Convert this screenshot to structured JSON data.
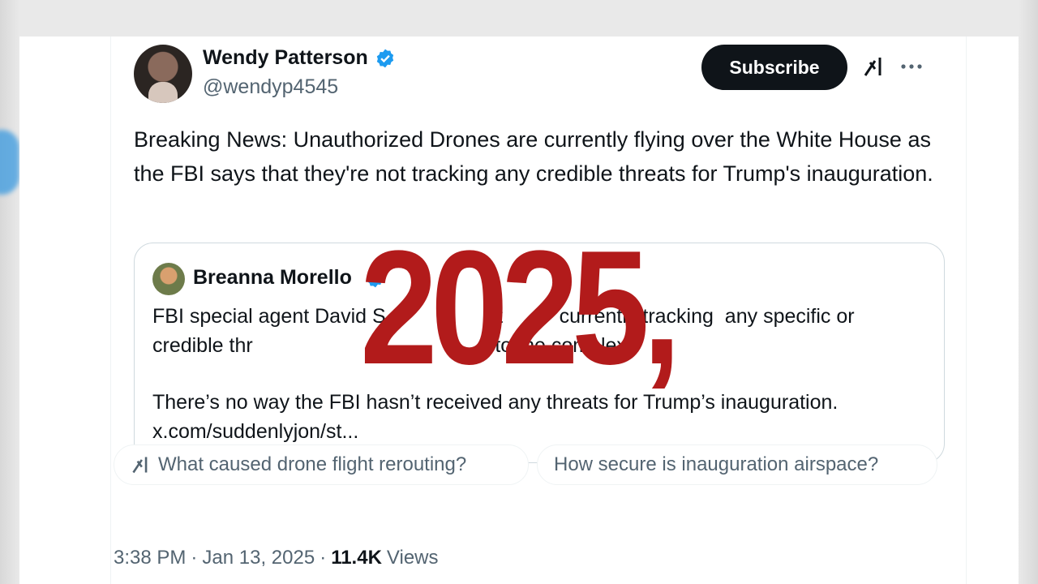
{
  "author": {
    "display_name": "Wendy Patterson",
    "handle": "@wendyp4545"
  },
  "header": {
    "subscribe_label": "Subscribe",
    "icons": [
      "grok-icon",
      "more-icon",
      "verified-icon"
    ]
  },
  "tweet": {
    "text": "Breaking News: Unauthorized Drones are currently flying over the White House as the FBI says that they're not tracking any credible threats for Trump's inauguration."
  },
  "quote": {
    "author_name": "Breanna Morello",
    "paragraph_1": "FBI special agent David S                   it          currently tracking  any specific or credible thr                                           to the complex.”",
    "paragraph_2": "There’s no way the FBI hasn’t received any threats for Trump’s inauguration.",
    "link": "x.com/suddenlyjon/st..."
  },
  "overlay": {
    "text": "2025,",
    "color": "#b21b1b"
  },
  "suggestions": [
    {
      "label": "What caused drone flight rerouting?"
    },
    {
      "label": "How secure is inauguration airspace?"
    }
  ],
  "meta": {
    "time": "3:38 PM",
    "separator": "·",
    "date": "Jan 13, 2025",
    "views_count": "11.4K",
    "views_label": "Views"
  },
  "colors": {
    "text_primary": "#0f1419",
    "text_secondary": "#536471",
    "verified_blue": "#1d9bf0",
    "border": "#cfd9de"
  }
}
